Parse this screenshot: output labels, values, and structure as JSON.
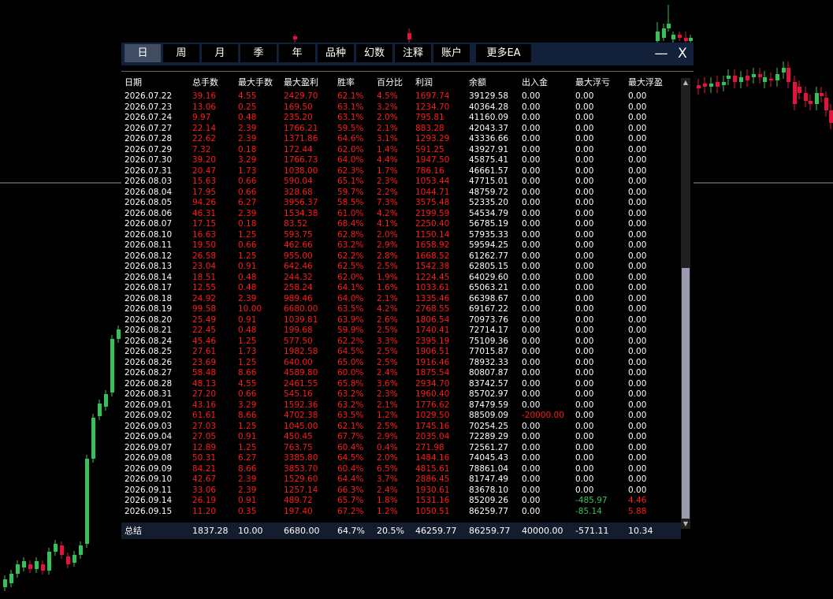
{
  "colors": {
    "bull": "#39c05a",
    "bear": "#e0143c",
    "loss": "#ff1a1a",
    "gain": "#39c05a",
    "panel_bg": "#000000",
    "tab_active": "#3f4c62",
    "tabbar": "#13203a"
  },
  "tabs": [
    "日",
    "周",
    "月",
    "季",
    "年",
    "品种",
    "幻数",
    "注释",
    "账户",
    "更多EA"
  ],
  "window": {
    "minimize": "—",
    "close": "X"
  },
  "icons": {
    "scroll_up": "triangle-up-icon",
    "scroll_down": "triangle-down-icon"
  },
  "columns": [
    "日期",
    "总手数",
    "最大手数",
    "最大盈利",
    "胜率",
    "百分比",
    "利润",
    "余额",
    "出入金",
    "最大浮亏",
    "最大浮盈"
  ],
  "rows": [
    [
      "2026.07.22",
      "39.16",
      "4.55",
      "2429.70",
      "62.1%",
      "4.5%",
      "1697.74",
      "39129.58",
      "0.00",
      "0.00",
      "0.00"
    ],
    [
      "2026.07.23",
      "13.06",
      "0.25",
      "169.50",
      "63.1%",
      "3.2%",
      "1234.70",
      "40364.28",
      "0.00",
      "0.00",
      "0.00"
    ],
    [
      "2026.07.24",
      "9.97",
      "0.48",
      "235.20",
      "63.1%",
      "2.0%",
      "795.81",
      "41160.09",
      "0.00",
      "0.00",
      "0.00"
    ],
    [
      "2026.07.27",
      "22.14",
      "2.39",
      "1766.21",
      "59.5%",
      "2.1%",
      "883.28",
      "42043.37",
      "0.00",
      "0.00",
      "0.00"
    ],
    [
      "2026.07.28",
      "22.62",
      "2.39",
      "1371.86",
      "64.6%",
      "3.1%",
      "1293.29",
      "43336.66",
      "0.00",
      "0.00",
      "0.00"
    ],
    [
      "2026.07.29",
      "7.32",
      "0.18",
      "172.44",
      "62.0%",
      "1.4%",
      "591.25",
      "43927.91",
      "0.00",
      "0.00",
      "0.00"
    ],
    [
      "2026.07.30",
      "39.20",
      "3.29",
      "1766.73",
      "64.0%",
      "4.4%",
      "1947.50",
      "45875.41",
      "0.00",
      "0.00",
      "0.00"
    ],
    [
      "2026.07.31",
      "20.47",
      "1.73",
      "1038.00",
      "62.3%",
      "1.7%",
      "786.16",
      "46661.57",
      "0.00",
      "0.00",
      "0.00"
    ],
    [
      "2026.08.03",
      "15.63",
      "0.66",
      "590.04",
      "65.1%",
      "2.3%",
      "1053.44",
      "47715.01",
      "0.00",
      "0.00",
      "0.00"
    ],
    [
      "2026.08.04",
      "17.95",
      "0.66",
      "328.68",
      "59.7%",
      "2.2%",
      "1044.71",
      "48759.72",
      "0.00",
      "0.00",
      "0.00"
    ],
    [
      "2026.08.05",
      "94.26",
      "6.27",
      "3956.37",
      "58.5%",
      "7.3%",
      "3575.48",
      "52335.20",
      "0.00",
      "0.00",
      "0.00"
    ],
    [
      "2026.08.06",
      "46.31",
      "2.39",
      "1534.38",
      "61.0%",
      "4.2%",
      "2199.59",
      "54534.79",
      "0.00",
      "0.00",
      "0.00"
    ],
    [
      "2026.08.07",
      "17.15",
      "0.18",
      "83.52",
      "68.4%",
      "4.1%",
      "2250.40",
      "56785.19",
      "0.00",
      "0.00",
      "0.00"
    ],
    [
      "2026.08.10",
      "16.63",
      "1.25",
      "593.75",
      "62.8%",
      "2.0%",
      "1150.14",
      "57935.33",
      "0.00",
      "0.00",
      "0.00"
    ],
    [
      "2026.08.11",
      "19.50",
      "0.66",
      "462.66",
      "63.2%",
      "2.9%",
      "1658.92",
      "59594.25",
      "0.00",
      "0.00",
      "0.00"
    ],
    [
      "2026.08.12",
      "26.58",
      "1.25",
      "955.00",
      "62.2%",
      "2.8%",
      "1668.52",
      "61262.77",
      "0.00",
      "0.00",
      "0.00"
    ],
    [
      "2026.08.13",
      "23.04",
      "0.91",
      "642.46",
      "62.5%",
      "2.5%",
      "1542.38",
      "62805.15",
      "0.00",
      "0.00",
      "0.00"
    ],
    [
      "2026.08.14",
      "18.51",
      "0.48",
      "244.32",
      "62.0%",
      "1.9%",
      "1224.45",
      "64029.60",
      "0.00",
      "0.00",
      "0.00"
    ],
    [
      "2026.08.17",
      "12.55",
      "0.48",
      "258.24",
      "64.1%",
      "1.6%",
      "1033.61",
      "65063.21",
      "0.00",
      "0.00",
      "0.00"
    ],
    [
      "2026.08.18",
      "24.92",
      "2.39",
      "989.46",
      "64.0%",
      "2.1%",
      "1335.46",
      "66398.67",
      "0.00",
      "0.00",
      "0.00"
    ],
    [
      "2026.08.19",
      "99.58",
      "10.00",
      "6680.00",
      "63.5%",
      "4.2%",
      "2768.55",
      "69167.22",
      "0.00",
      "0.00",
      "0.00"
    ],
    [
      "2026.08.20",
      "25.49",
      "0.91",
      "1039.81",
      "63.9%",
      "2.6%",
      "1806.54",
      "70973.76",
      "0.00",
      "0.00",
      "0.00"
    ],
    [
      "2026.08.21",
      "22.45",
      "0.48",
      "199.68",
      "59.9%",
      "2.5%",
      "1740.41",
      "72714.17",
      "0.00",
      "0.00",
      "0.00"
    ],
    [
      "2026.08.24",
      "45.46",
      "1.25",
      "577.50",
      "62.2%",
      "3.3%",
      "2395.19",
      "75109.36",
      "0.00",
      "0.00",
      "0.00"
    ],
    [
      "2026.08.25",
      "27.61",
      "1.73",
      "1982.58",
      "64.5%",
      "2.5%",
      "1906.51",
      "77015.87",
      "0.00",
      "0.00",
      "0.00"
    ],
    [
      "2026.08.26",
      "23.69",
      "1.25",
      "640.00",
      "65.0%",
      "2.5%",
      "1916.46",
      "78932.33",
      "0.00",
      "0.00",
      "0.00"
    ],
    [
      "2026.08.27",
      "58.48",
      "8.66",
      "4589.80",
      "60.0%",
      "2.4%",
      "1875.54",
      "80807.87",
      "0.00",
      "0.00",
      "0.00"
    ],
    [
      "2026.08.28",
      "48.13",
      "4.55",
      "2461.55",
      "65.8%",
      "3.6%",
      "2934.70",
      "83742.57",
      "0.00",
      "0.00",
      "0.00"
    ],
    [
      "2026.08.31",
      "27.20",
      "0.66",
      "545.16",
      "63.2%",
      "2.3%",
      "1960.40",
      "85702.97",
      "0.00",
      "0.00",
      "0.00"
    ],
    [
      "2026.09.01",
      "43.16",
      "3.29",
      "1592.36",
      "63.2%",
      "2.1%",
      "1776.62",
      "87479.59",
      "0.00",
      "0.00",
      "0.00"
    ],
    [
      "2026.09.02",
      "61.61",
      "8.66",
      "4702.38",
      "63.5%",
      "1.2%",
      "1029.50",
      "88509.09",
      "-20000.00",
      "0.00",
      "0.00"
    ],
    [
      "2026.09.03",
      "27.03",
      "1.25",
      "1045.00",
      "62.1%",
      "2.5%",
      "1745.16",
      "70254.25",
      "0.00",
      "0.00",
      "0.00"
    ],
    [
      "2026.09.04",
      "27.05",
      "0.91",
      "450.45",
      "67.7%",
      "2.9%",
      "2035.04",
      "72289.29",
      "0.00",
      "0.00",
      "0.00"
    ],
    [
      "2026.09.07",
      "12.89",
      "1.25",
      "763.75",
      "60.4%",
      "0.4%",
      "271.98",
      "72561.27",
      "0.00",
      "0.00",
      "0.00"
    ],
    [
      "2026.09.08",
      "50.31",
      "6.27",
      "3385.80",
      "64.5%",
      "2.0%",
      "1484.16",
      "74045.43",
      "0.00",
      "0.00",
      "0.00"
    ],
    [
      "2026.09.09",
      "84.21",
      "8.66",
      "3853.70",
      "60.4%",
      "6.5%",
      "4815.61",
      "78861.04",
      "0.00",
      "0.00",
      "0.00"
    ],
    [
      "2026.09.10",
      "42.67",
      "2.39",
      "1529.60",
      "64.4%",
      "3.7%",
      "2886.45",
      "81747.49",
      "0.00",
      "0.00",
      "0.00"
    ],
    [
      "2026.09.11",
      "33.06",
      "2.39",
      "1257.14",
      "66.3%",
      "2.4%",
      "1930.61",
      "83678.10",
      "0.00",
      "0.00",
      "0.00"
    ],
    [
      "2026.09.14",
      "26.19",
      "0.91",
      "489.72",
      "65.7%",
      "1.8%",
      "1531.16",
      "85209.26",
      "0.00",
      "-485.97",
      "4.46"
    ],
    [
      "2026.09.15",
      "11.20",
      "0.35",
      "197.40",
      "67.2%",
      "1.2%",
      "1050.51",
      "86259.77",
      "0.00",
      "-85.14",
      "5.88"
    ]
  ],
  "summary": [
    "总结",
    "1837.28",
    "10.00",
    "6680.00",
    "64.7%",
    "20.5%",
    "46259.77",
    "86259.77",
    "40000.00",
    "-571.11",
    "10.34"
  ]
}
